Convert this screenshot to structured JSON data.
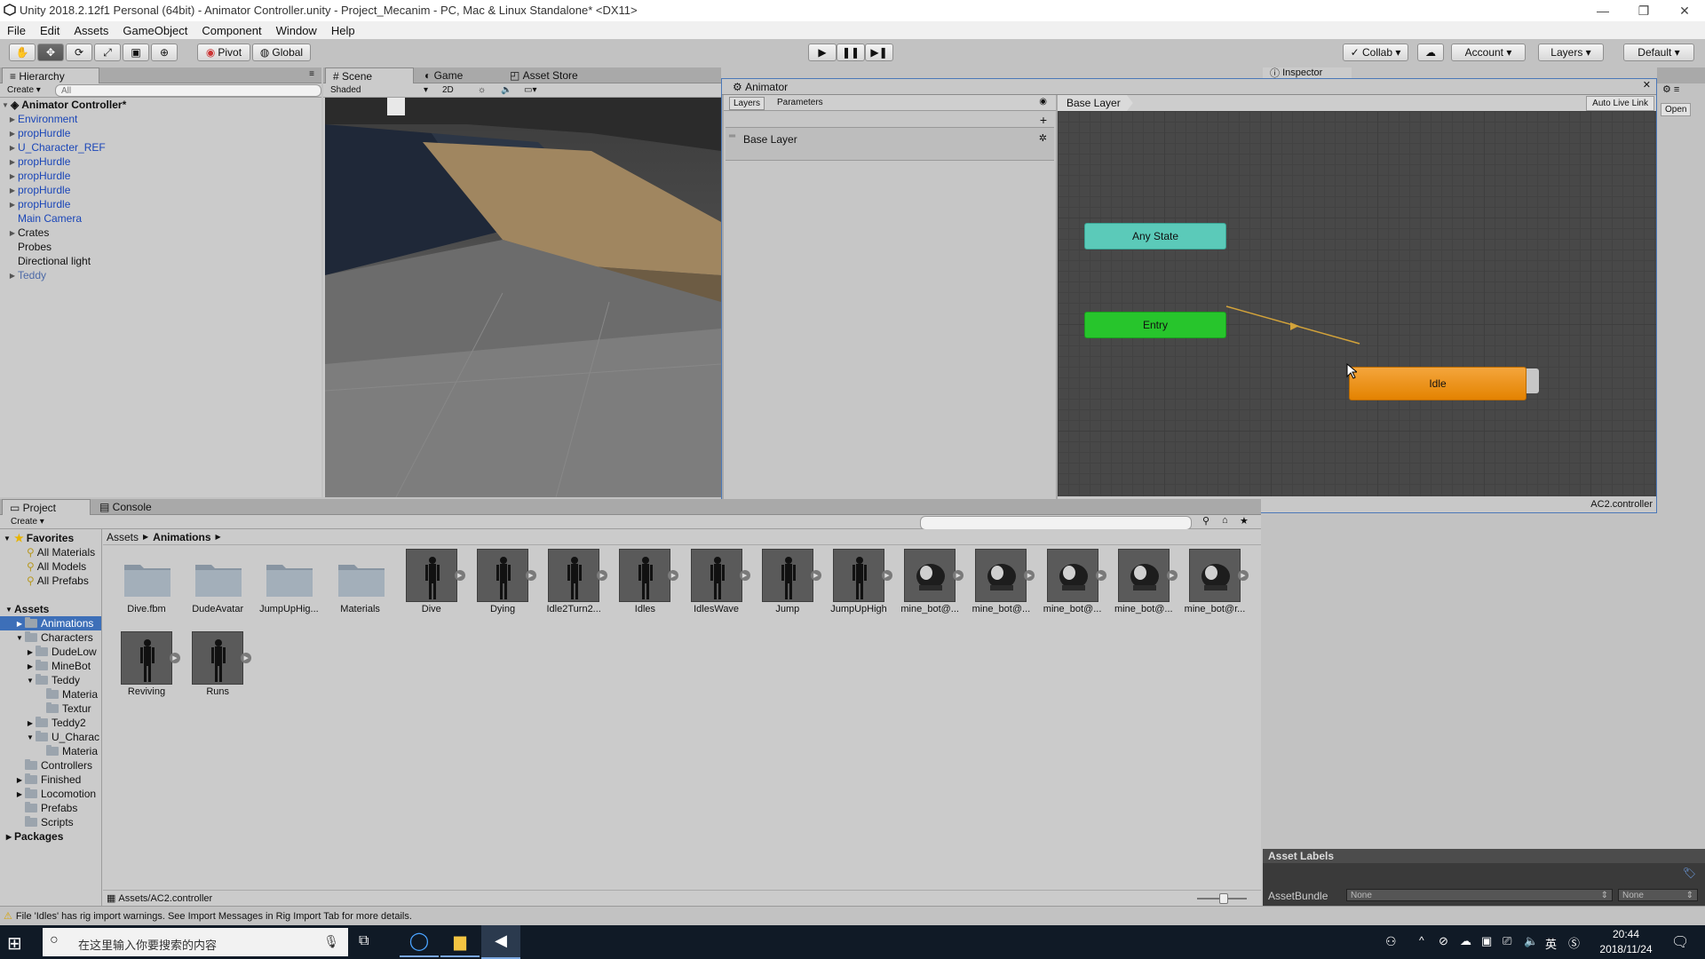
{
  "window": {
    "title": "Unity 2018.2.12f1 Personal (64bit) - Animator Controller.unity - Project_Mecanim - PC, Mac & Linux Standalone* <DX11>",
    "min": "—",
    "max": "❐",
    "close": "✕"
  },
  "menu": [
    "File",
    "Edit",
    "Assets",
    "GameObject",
    "Component",
    "Window",
    "Help"
  ],
  "toolbar": {
    "pivot": "Pivot",
    "global": "Global",
    "collab": "Collab",
    "account": "Account",
    "layers": "Layers",
    "layout": "Default"
  },
  "hierarchy": {
    "tab": "Hierarchy",
    "create": "Create",
    "search_placeholder": "All",
    "scene": "Animator Controller*",
    "items": [
      {
        "label": "Environment",
        "expandable": true,
        "style": "blue"
      },
      {
        "label": "propHurdle",
        "expandable": true,
        "style": "blue"
      },
      {
        "label": "U_Character_REF",
        "expandable": true,
        "style": "blue"
      },
      {
        "label": "propHurdle",
        "expandable": true,
        "style": "blue"
      },
      {
        "label": "propHurdle",
        "expandable": true,
        "style": "blue"
      },
      {
        "label": "propHurdle",
        "expandable": true,
        "style": "blue"
      },
      {
        "label": "propHurdle",
        "expandable": true,
        "style": "blue"
      },
      {
        "label": "Main Camera",
        "expandable": false,
        "style": "blue"
      },
      {
        "label": "Crates",
        "expandable": true,
        "style": "normal"
      },
      {
        "label": "Probes",
        "expandable": false,
        "style": "normal"
      },
      {
        "label": "Directional light",
        "expandable": false,
        "style": "normal"
      },
      {
        "label": "Teddy",
        "expandable": true,
        "style": "grayish"
      }
    ]
  },
  "scene": {
    "tabs": [
      "Scene",
      "Game",
      "Asset Store"
    ],
    "shading": "Shaded",
    "mode2d": "2D"
  },
  "animator": {
    "tab": "Animator",
    "left_tabs": [
      "Layers",
      "Parameters"
    ],
    "add": "+",
    "layer_name": "Base Layer",
    "breadcrumb": "Base Layer",
    "auto_live_link": "Auto Live Link",
    "nodes": {
      "any_state": "Any State",
      "entry": "Entry",
      "idle": "Idle"
    },
    "footer": "AC2.controller"
  },
  "inspector": {
    "tab": "Inspector",
    "open": "Open",
    "asset_labels": "Asset Labels",
    "asset_bundle": "AssetBundle",
    "bundle_value": "None",
    "variant_value": "None"
  },
  "project": {
    "tabs": [
      "Project",
      "Console"
    ],
    "create": "Create",
    "breadcrumb": [
      "Assets",
      "Animations"
    ],
    "favorites": {
      "label": "Favorites",
      "items": [
        "All Materials",
        "All Models",
        "All Prefabs"
      ]
    },
    "tree": [
      {
        "label": "Assets",
        "level": 0,
        "bold": true,
        "expanded": true
      },
      {
        "label": "Animations",
        "level": 1,
        "selected": true,
        "arrow": "right"
      },
      {
        "label": "Characters",
        "level": 1,
        "arrow": "down"
      },
      {
        "label": "DudeLow",
        "level": 2,
        "arrow": "right"
      },
      {
        "label": "MineBot",
        "level": 2,
        "arrow": "right"
      },
      {
        "label": "Teddy",
        "level": 2,
        "arrow": "down"
      },
      {
        "label": "Materia",
        "level": 3,
        "arrow": ""
      },
      {
        "label": "Textur",
        "level": 3,
        "arrow": ""
      },
      {
        "label": "Teddy2",
        "level": 2,
        "arrow": "right"
      },
      {
        "label": "U_Charac",
        "level": 2,
        "arrow": "down"
      },
      {
        "label": "Materia",
        "level": 3,
        "arrow": ""
      },
      {
        "label": "Controllers",
        "level": 1,
        "arrow": ""
      },
      {
        "label": "Finished",
        "level": 1,
        "arrow": "right"
      },
      {
        "label": "Locomotion",
        "level": 1,
        "arrow": "right"
      },
      {
        "label": "Prefabs",
        "level": 1,
        "arrow": ""
      },
      {
        "label": "Scripts",
        "level": 1,
        "arrow": ""
      },
      {
        "label": "Packages",
        "level": 0,
        "bold": true,
        "arrow": "right"
      }
    ],
    "assets": [
      {
        "label": "Dive.fbm",
        "kind": "folder"
      },
      {
        "label": "DudeAvatar",
        "kind": "folder"
      },
      {
        "label": "JumpUpHig...",
        "kind": "folder"
      },
      {
        "label": "Materials",
        "kind": "folder"
      },
      {
        "label": "Dive",
        "kind": "anim"
      },
      {
        "label": "Dying",
        "kind": "anim"
      },
      {
        "label": "Idle2Turn2...",
        "kind": "anim"
      },
      {
        "label": "Idles",
        "kind": "anim"
      },
      {
        "label": "IdlesWave",
        "kind": "anim"
      },
      {
        "label": "Jump",
        "kind": "anim"
      },
      {
        "label": "JumpUpHigh",
        "kind": "anim"
      },
      {
        "label": "mine_bot@...",
        "kind": "bot"
      },
      {
        "label": "mine_bot@...",
        "kind": "bot"
      },
      {
        "label": "mine_bot@...",
        "kind": "bot"
      },
      {
        "label": "mine_bot@...",
        "kind": "bot"
      },
      {
        "label": "mine_bot@r...",
        "kind": "bot"
      },
      {
        "label": "Reviving",
        "kind": "anim"
      },
      {
        "label": "Runs",
        "kind": "anim"
      }
    ],
    "path": "Assets/AC2.controller"
  },
  "status": "File 'Idles' has rig import warnings. See Import Messages in Rig Import Tab for more details.",
  "taskbar": {
    "search_placeholder": "在这里输入你要搜索的内容",
    "ime": "英",
    "time": "20:44",
    "date": "2018/11/24"
  }
}
